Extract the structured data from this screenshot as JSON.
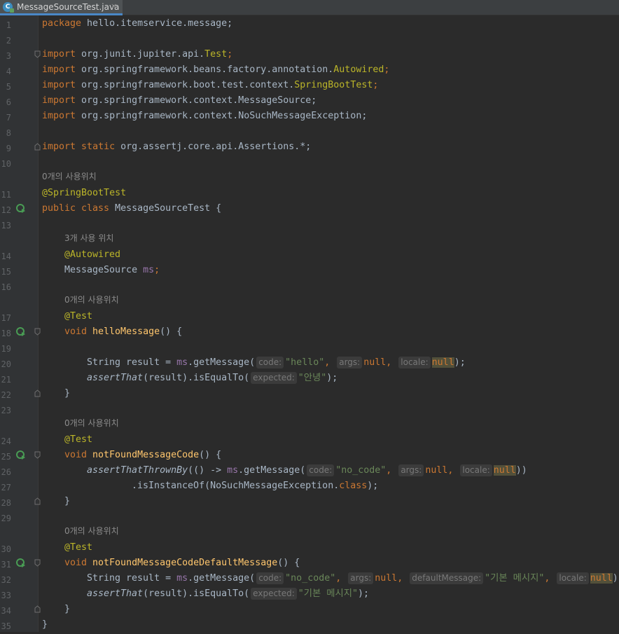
{
  "tab": {
    "filename": "MessageSourceTest.java",
    "icon": "java-class-icon",
    "close": "×"
  },
  "colors": {
    "keyword": "#cc7832",
    "annotation": "#bbb529",
    "string": "#6a8759",
    "field": "#9876aa",
    "method": "#ffc66d",
    "text": "#a9b7c6",
    "background": "#2b2b2b"
  },
  "line_numbers": [
    "1",
    "2",
    "3",
    "4",
    "5",
    "6",
    "7",
    "8",
    "9",
    "10",
    "11",
    "12",
    "13",
    "14",
    "15",
    "16",
    "17",
    "18",
    "19",
    "20",
    "21",
    "22",
    "23",
    "24",
    "25",
    "26",
    "27",
    "28",
    "29",
    "30",
    "31",
    "32",
    "33",
    "34",
    "35"
  ],
  "hints": {
    "class_usages": "0개의 사용위치",
    "field_usages": "3개 사용 위치",
    "t1_usages": "0개의 사용위치",
    "t2_usages": "0개의 사용위치",
    "t3_usages": "0개의 사용위치"
  },
  "code": {
    "l1": {
      "kw": "package",
      "rest": " hello.itemservice.message;"
    },
    "l3": {
      "kw": "import",
      "rest": " org.junit.jupiter.api.",
      "cls": "Test",
      "end": ";"
    },
    "l4": {
      "kw": "import",
      "rest": " org.springframework.beans.factory.annotation.",
      "cls": "Autowired",
      "end": ";"
    },
    "l5": {
      "kw": "import",
      "rest": " org.springframework.boot.test.context.",
      "cls": "SpringBootTest",
      "end": ";"
    },
    "l6": {
      "kw": "import",
      "rest": " org.springframework.context.MessageSource;"
    },
    "l7": {
      "kw": "import",
      "rest": " org.springframework.context.NoSuchMessageException;"
    },
    "l9": {
      "kw": "import",
      "kw2": " static",
      "rest": " org.assertj.core.api.Assertions.*;"
    },
    "l11": {
      "ann": "@SpringBootTest"
    },
    "l12": {
      "kw": "public class",
      "rest": " MessageSourceTest {"
    },
    "l14": {
      "ann": "@Autowired"
    },
    "l15": {
      "type": "MessageSource ",
      "field": "ms",
      "end": ";"
    },
    "l17": {
      "ann": "@Test"
    },
    "l18": {
      "kw": "void ",
      "fn": "helloMessage",
      "rest": "() {"
    },
    "l20": {
      "a": "String result = ",
      "ms": "ms",
      "b": ".getMessage(",
      "h1": "code:",
      "s1": "\"hello\"",
      "c1": ", ",
      "h2": "args:",
      "n1": "null",
      "c2": ", ",
      "h3": "locale:",
      "n2": "null",
      "end": ");"
    },
    "l21": {
      "fn": "assertThat",
      "a": "(result).isEqualTo(",
      "h1": "expected:",
      "s1": "\"안녕\"",
      "end": ");"
    },
    "l22": {
      "text": "}"
    },
    "l24": {
      "ann": "@Test"
    },
    "l25": {
      "kw": "void ",
      "fn": "notFoundMessageCode",
      "rest": "() {"
    },
    "l26": {
      "fn": "assertThatThrownBy",
      "a": "(() -> ",
      "ms": "ms",
      "b": ".getMessage(",
      "h1": "code:",
      "s1": "\"no_code\"",
      "c1": ", ",
      "h2": "args:",
      "n1": "null",
      "c2": ", ",
      "h3": "locale:",
      "n2": "null",
      "end": "))"
    },
    "l27": {
      "a": ".isInstanceOf(NoSuchMessageException.",
      "kw": "class",
      "end": ");"
    },
    "l28": {
      "text": "}"
    },
    "l30": {
      "ann": "@Test"
    },
    "l31": {
      "kw": "void ",
      "fn": "notFoundMessageCodeDefaultMessage",
      "rest": "() {"
    },
    "l32": {
      "a": "String result = ",
      "ms": "ms",
      "b": ".getMessage(",
      "h1": "code:",
      "s1": "\"no_code\"",
      "c1": ", ",
      "h2": "args:",
      "n1": "null",
      "c2": ", ",
      "h3": "defaultMessage:",
      "s2": "\"기본 메시지\"",
      "c3": ", ",
      "h4": "locale:",
      "n2": "null",
      "end": ");"
    },
    "l33": {
      "fn": "assertThat",
      "a": "(result).isEqualTo(",
      "h1": "expected:",
      "s1": "\"기본 메시지\"",
      "end": ");"
    },
    "l34": {
      "text": "}"
    },
    "l35": {
      "text": "}"
    }
  }
}
